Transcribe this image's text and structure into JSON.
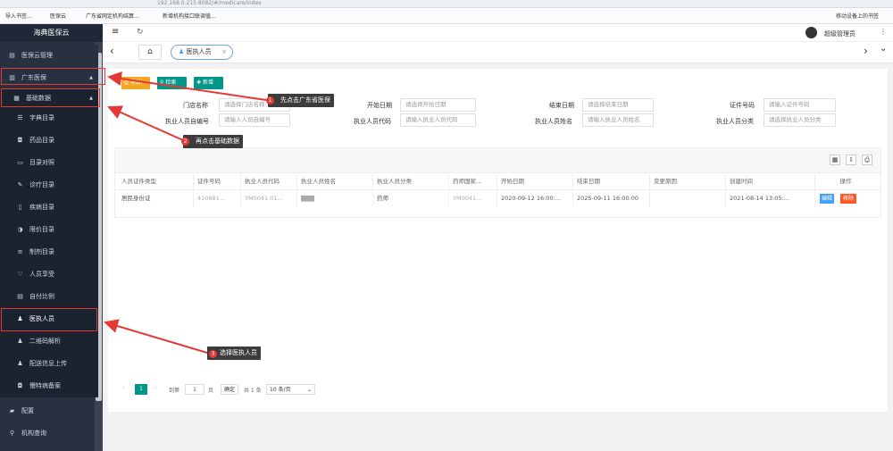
{
  "browser": {
    "url": "192.168.0.215:8082/#/medicare/index",
    "bookmarks": [
      "导入书签...",
      "医保云",
      "广东省网定机构结算...",
      "新增机构接口联调值..."
    ],
    "mobile_bookmarks": "移动设备上的书签"
  },
  "sidebar": {
    "title": "海典医保云",
    "items": [
      {
        "label": "医保云管理",
        "icon": "▤"
      },
      {
        "label": "广东医保",
        "icon": "▥"
      },
      {
        "label": "基础数据",
        "icon": "▦"
      },
      {
        "label": "字典目录",
        "icon": "☰"
      },
      {
        "label": "药品目录",
        "icon": "◘"
      },
      {
        "label": "目录对照",
        "icon": "▭"
      },
      {
        "label": "诊疗目录",
        "icon": "✎"
      },
      {
        "label": "疾病目录",
        "icon": "▯"
      },
      {
        "label": "限价目录",
        "icon": "◑"
      },
      {
        "label": "制剂目录",
        "icon": "≡"
      },
      {
        "label": "人员享受",
        "icon": "♡"
      },
      {
        "label": "自付比例",
        "icon": "▤"
      },
      {
        "label": "医执人员",
        "icon": "♟"
      },
      {
        "label": "二维码解析",
        "icon": "♟"
      },
      {
        "label": "配送信息上传",
        "icon": "♟"
      },
      {
        "label": "慢特病备案",
        "icon": "◘"
      },
      {
        "label": "配置",
        "icon": "▰"
      },
      {
        "label": "机构查询",
        "icon": "⚲"
      }
    ]
  },
  "topbar": {
    "menu_icon": "≡",
    "refresh_icon": "↻",
    "user": "超级管理员",
    "more_icon": "⋮"
  },
  "tabs": {
    "home_icon": "⌂",
    "active": "医执人员",
    "close": "×",
    "left_arrow": "‹",
    "right_arrow": "›",
    "down_arrow": "⌄"
  },
  "toolbar": {
    "export": "导出",
    "search": "检索",
    "add": "新增"
  },
  "form": {
    "store_label": "门店名称",
    "store_placeholder": "请选择门店名称",
    "start_label": "开始日期",
    "start_placeholder": "请选择开始日期",
    "end_label": "结束日期",
    "end_placeholder": "请选择结束日期",
    "cert_label": "证件号码",
    "cert_placeholder": "请输入证件号码",
    "selfno_label": "执业人员自编号",
    "selfno_placeholder": "请输入人员自编号",
    "code_label": "执业人员代码",
    "code_placeholder": "请输入执业人员代码",
    "name_label": "执业人员姓名",
    "name_placeholder": "请输入执业人员姓名",
    "category_label": "执业人员分类",
    "category_placeholder": "请选择执业人员分类"
  },
  "table": {
    "headers": [
      "人员证件类型",
      "证件号码",
      "执业人员代码",
      "执业人员姓名",
      "执业人员分类",
      "药师国家...",
      "开始日期",
      "结束日期",
      "变更原因",
      "创建时间",
      "操作"
    ],
    "row": [
      "居民身份证",
      "410881...",
      "YM0041.01...",
      "▇▇▇",
      "药师",
      "YM0041...",
      "2020-09-12 16:00:...",
      "2025-09-11 16:00:00",
      "",
      "2021-08-14 13:05:..."
    ],
    "edit": "编辑",
    "delete": "移除"
  },
  "pager": {
    "prev": "‹",
    "page": "1",
    "next": "›",
    "goto": "到第",
    "page_input": "1",
    "page_unit": "页",
    "confirm": "确定",
    "total": "共 1 条",
    "size": "10 条/页"
  },
  "annotations": [
    {
      "num": "1",
      "text": "先点击广东省医保"
    },
    {
      "num": "2",
      "text": "再点击基础数据"
    },
    {
      "num": "3",
      "text": "选择医执人员"
    }
  ],
  "colors": {
    "sidebar": "#28313f",
    "active": "#409eff",
    "export": "#f5a623",
    "search": "#009688",
    "add": "#009688",
    "edit": "#409eff",
    "delete": "#ff5722",
    "annot_red": "#e53935"
  }
}
